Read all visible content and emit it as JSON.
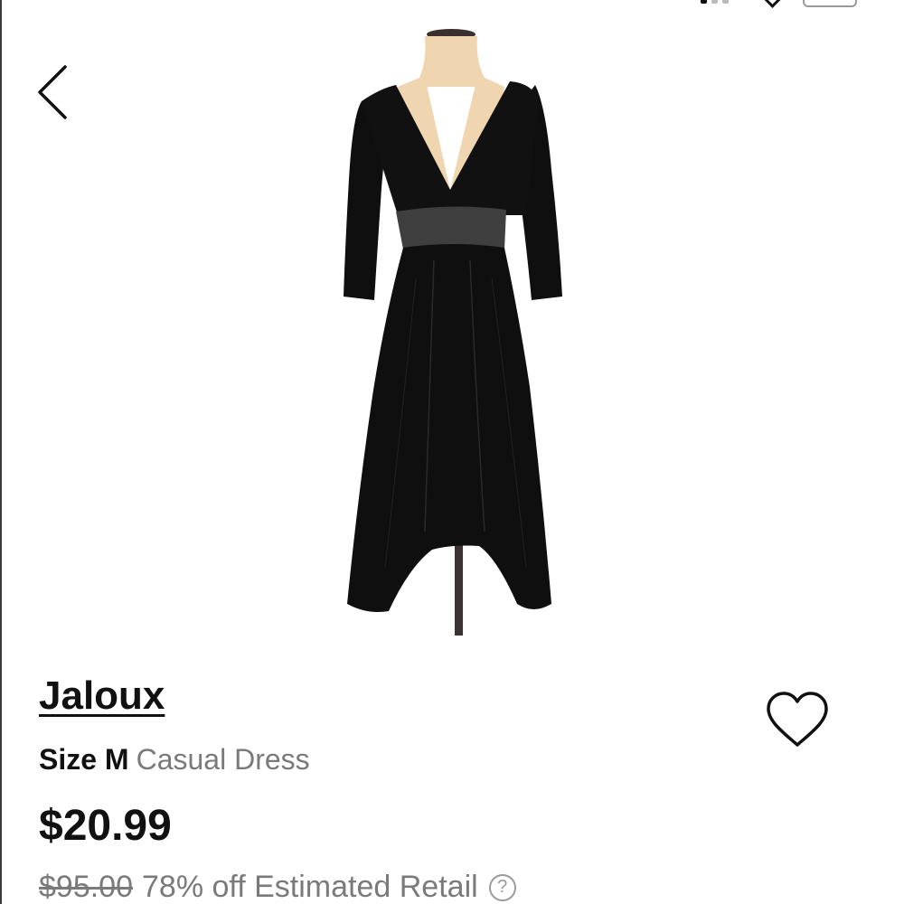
{
  "navigation": {
    "back_icon": "chevron-left-icon"
  },
  "product": {
    "image_alt": "black casual dress on mannequin",
    "brand": "Jaloux",
    "size_label": "Size M",
    "category": "Casual Dress",
    "price": "$20.99",
    "original_price": "$95.00",
    "discount_text": "78% off Estimated Retail",
    "info_icon": "question-circle-icon",
    "info_glyph": "?",
    "favorite_icon": "heart-outline-icon"
  },
  "colors": {
    "text_primary": "#111111",
    "text_secondary": "#7a7a7a",
    "dress_black": "#0f0f0f",
    "waistband_gray": "#3f3f3f",
    "mannequin_skin": "#efd6b0"
  }
}
